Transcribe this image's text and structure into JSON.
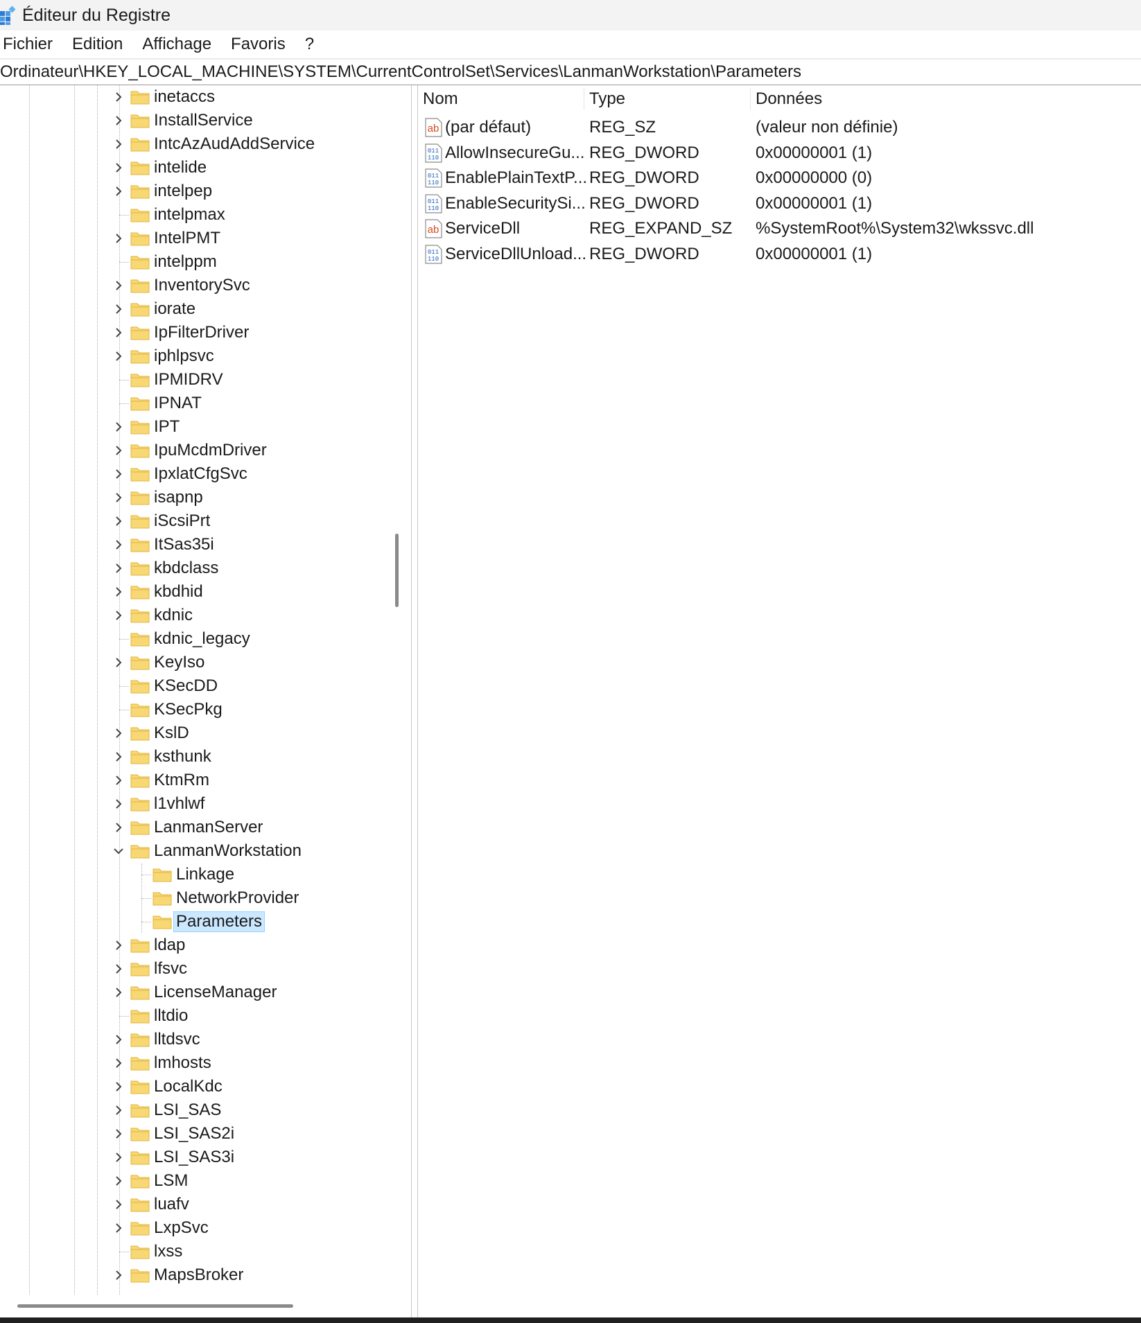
{
  "window": {
    "title": "Éditeur du Registre"
  },
  "menu": [
    "Fichier",
    "Edition",
    "Affichage",
    "Favoris",
    "?"
  ],
  "address": "Ordinateur\\HKEY_LOCAL_MACHINE\\SYSTEM\\CurrentControlSet\\Services\\LanmanWorkstation\\Parameters",
  "tree": [
    {
      "label": "inetaccs",
      "level": 0,
      "expander": "collapsed"
    },
    {
      "label": "InstallService",
      "level": 0,
      "expander": "collapsed"
    },
    {
      "label": "IntcAzAudAddService",
      "level": 0,
      "expander": "collapsed"
    },
    {
      "label": "intelide",
      "level": 0,
      "expander": "collapsed"
    },
    {
      "label": "intelpep",
      "level": 0,
      "expander": "collapsed"
    },
    {
      "label": "intelpmax",
      "level": 0,
      "expander": "none"
    },
    {
      "label": "IntelPMT",
      "level": 0,
      "expander": "collapsed"
    },
    {
      "label": "intelppm",
      "level": 0,
      "expander": "none"
    },
    {
      "label": "InventorySvc",
      "level": 0,
      "expander": "collapsed"
    },
    {
      "label": "iorate",
      "level": 0,
      "expander": "collapsed"
    },
    {
      "label": "IpFilterDriver",
      "level": 0,
      "expander": "collapsed"
    },
    {
      "label": "iphlpsvc",
      "level": 0,
      "expander": "collapsed"
    },
    {
      "label": "IPMIDRV",
      "level": 0,
      "expander": "none"
    },
    {
      "label": "IPNAT",
      "level": 0,
      "expander": "none"
    },
    {
      "label": "IPT",
      "level": 0,
      "expander": "collapsed"
    },
    {
      "label": "IpuMcdmDriver",
      "level": 0,
      "expander": "collapsed"
    },
    {
      "label": "IpxlatCfgSvc",
      "level": 0,
      "expander": "collapsed"
    },
    {
      "label": "isapnp",
      "level": 0,
      "expander": "collapsed"
    },
    {
      "label": "iScsiPrt",
      "level": 0,
      "expander": "collapsed"
    },
    {
      "label": "ItSas35i",
      "level": 0,
      "expander": "collapsed"
    },
    {
      "label": "kbdclass",
      "level": 0,
      "expander": "collapsed"
    },
    {
      "label": "kbdhid",
      "level": 0,
      "expander": "collapsed"
    },
    {
      "label": "kdnic",
      "level": 0,
      "expander": "collapsed"
    },
    {
      "label": "kdnic_legacy",
      "level": 0,
      "expander": "none"
    },
    {
      "label": "KeyIso",
      "level": 0,
      "expander": "collapsed"
    },
    {
      "label": "KSecDD",
      "level": 0,
      "expander": "none"
    },
    {
      "label": "KSecPkg",
      "level": 0,
      "expander": "none"
    },
    {
      "label": "KslD",
      "level": 0,
      "expander": "collapsed"
    },
    {
      "label": "ksthunk",
      "level": 0,
      "expander": "collapsed"
    },
    {
      "label": "KtmRm",
      "level": 0,
      "expander": "collapsed"
    },
    {
      "label": "l1vhlwf",
      "level": 0,
      "expander": "collapsed"
    },
    {
      "label": "LanmanServer",
      "level": 0,
      "expander": "collapsed"
    },
    {
      "label": "LanmanWorkstation",
      "level": 0,
      "expander": "expanded"
    },
    {
      "label": "Linkage",
      "level": 1,
      "expander": "none"
    },
    {
      "label": "NetworkProvider",
      "level": 1,
      "expander": "none"
    },
    {
      "label": "Parameters",
      "level": 1,
      "expander": "none",
      "selected": true
    },
    {
      "label": "ldap",
      "level": 0,
      "expander": "collapsed"
    },
    {
      "label": "lfsvc",
      "level": 0,
      "expander": "collapsed"
    },
    {
      "label": "LicenseManager",
      "level": 0,
      "expander": "collapsed"
    },
    {
      "label": "lltdio",
      "level": 0,
      "expander": "none"
    },
    {
      "label": "lltdsvc",
      "level": 0,
      "expander": "collapsed"
    },
    {
      "label": "lmhosts",
      "level": 0,
      "expander": "collapsed"
    },
    {
      "label": "LocalKdc",
      "level": 0,
      "expander": "collapsed"
    },
    {
      "label": "LSI_SAS",
      "level": 0,
      "expander": "collapsed"
    },
    {
      "label": "LSI_SAS2i",
      "level": 0,
      "expander": "collapsed"
    },
    {
      "label": "LSI_SAS3i",
      "level": 0,
      "expander": "collapsed"
    },
    {
      "label": "LSM",
      "level": 0,
      "expander": "collapsed"
    },
    {
      "label": "luafv",
      "level": 0,
      "expander": "collapsed"
    },
    {
      "label": "LxpSvc",
      "level": 0,
      "expander": "collapsed"
    },
    {
      "label": "lxss",
      "level": 0,
      "expander": "none"
    },
    {
      "label": "MapsBroker",
      "level": 0,
      "expander": "collapsed"
    }
  ],
  "list": {
    "headers": {
      "name": "Nom",
      "type": "Type",
      "data": "Données"
    },
    "rows": [
      {
        "icon": "string-value-icon",
        "name": "(par défaut)",
        "type": "REG_SZ",
        "data": "(valeur non définie)"
      },
      {
        "icon": "binary-value-icon",
        "name": "AllowInsecureGu...",
        "type": "REG_DWORD",
        "data": "0x00000001 (1)"
      },
      {
        "icon": "binary-value-icon",
        "name": "EnablePlainTextP...",
        "type": "REG_DWORD",
        "data": "0x00000000 (0)"
      },
      {
        "icon": "binary-value-icon",
        "name": "EnableSecuritySi...",
        "type": "REG_DWORD",
        "data": "0x00000001 (1)"
      },
      {
        "icon": "string-value-icon",
        "name": "ServiceDll",
        "type": "REG_EXPAND_SZ",
        "data": "%SystemRoot%\\System32\\wkssvc.dll"
      },
      {
        "icon": "binary-value-icon",
        "name": "ServiceDllUnload...",
        "type": "REG_DWORD",
        "data": "0x00000001 (1)"
      }
    ]
  },
  "colors": {
    "selection": "#cce8ff",
    "selection_border": "#99d1ff",
    "folder": "#f8d775",
    "string_icon": "#d84a1b",
    "binary_icon": "#1f5fbf"
  }
}
